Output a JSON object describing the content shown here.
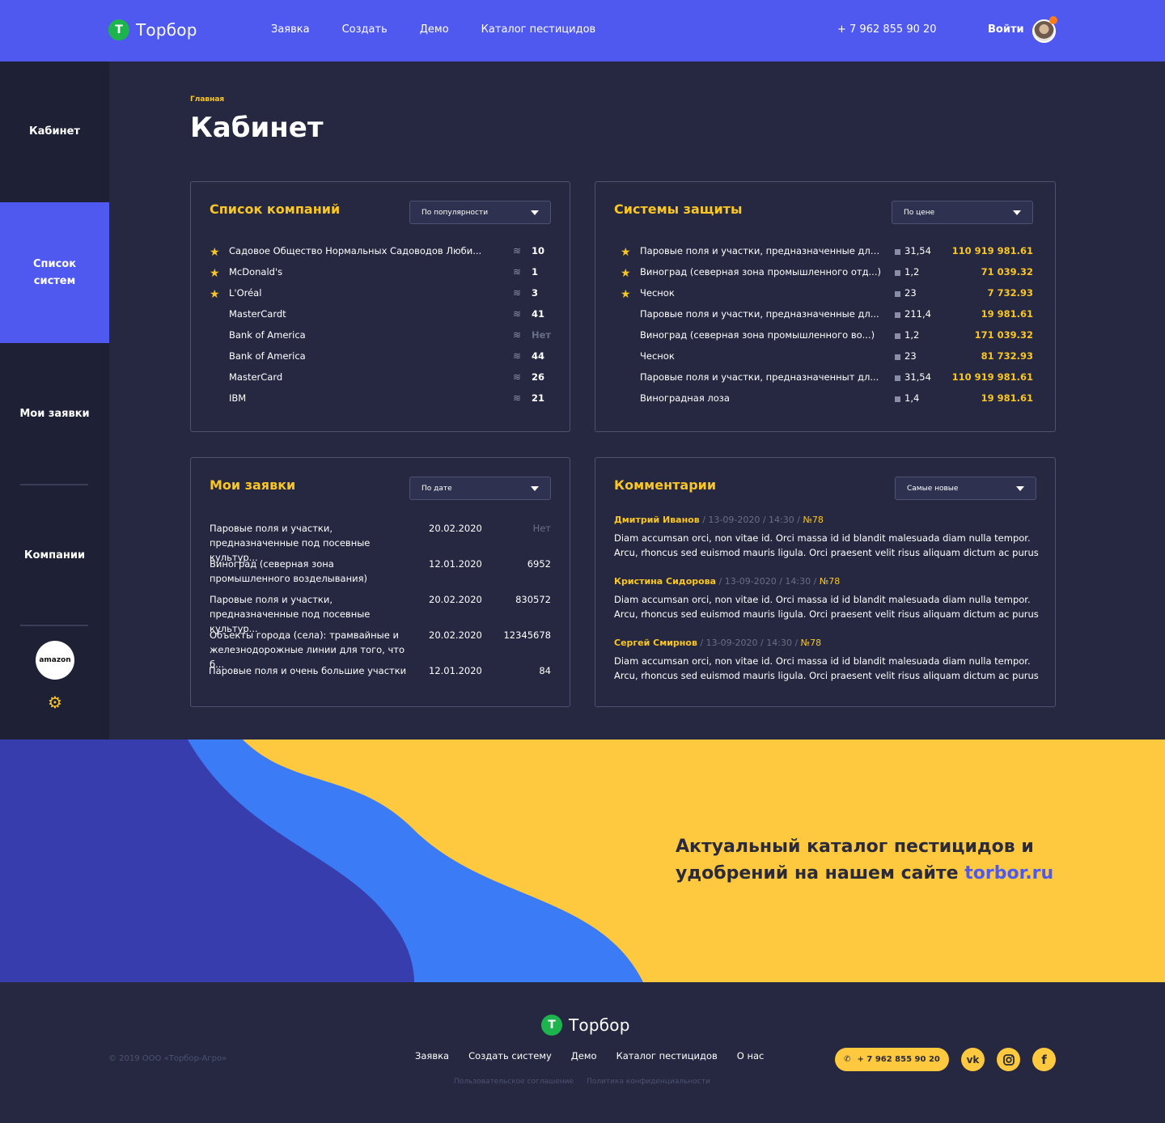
{
  "header": {
    "logo_mark": "Т",
    "logo_text": "Торбор",
    "nav": [
      "Заявка",
      "Создать",
      "Демо",
      "Каталог пестицидов"
    ],
    "phone": "+ 7 962 855 90 20",
    "login": "Войти"
  },
  "sidebar": {
    "items": [
      {
        "label": "Кабинет"
      },
      {
        "label": "Список систем"
      },
      {
        "label": "Мои заявки"
      },
      {
        "label": "Компании"
      }
    ],
    "company_logo": "amazon",
    "gear_icon": "⚙"
  },
  "page": {
    "breadcrumb": "Главная",
    "title": "Кабинет"
  },
  "companies": {
    "title": "Список компаний",
    "sort": "По популярности",
    "rows": [
      {
        "name": "Садовое Общество Нормальных Садоводов Люби...",
        "starred": true,
        "count": "10"
      },
      {
        "name": "McDonald's",
        "starred": true,
        "count": "1"
      },
      {
        "name": "L'Oréal",
        "starred": true,
        "count": "3"
      },
      {
        "name": "MasterCardt",
        "starred": false,
        "count": "41"
      },
      {
        "name": "Bank of America",
        "starred": false,
        "count": "Нет"
      },
      {
        "name": "Bank of America",
        "starred": false,
        "count": "44"
      },
      {
        "name": "MasterCard",
        "starred": false,
        "count": "26"
      },
      {
        "name": "IBM",
        "starred": false,
        "count": "21"
      }
    ]
  },
  "systems": {
    "title": "Системы защиты",
    "sort": "По цене",
    "rows": [
      {
        "name": "Паровые поля и участки, предназначенные для...",
        "starred": true,
        "area": "31,54",
        "price": "110 919 981.61"
      },
      {
        "name": "Виноград (северная зона промышленного отд...)",
        "starred": true,
        "area": "1,2",
        "price": "71 039.32"
      },
      {
        "name": "Чеснок",
        "starred": true,
        "area": "23",
        "price": "7 732.93"
      },
      {
        "name": "Паровые поля и участки, предназначенные дл...",
        "starred": false,
        "area": "211,4",
        "price": "19 981.61"
      },
      {
        "name": "Виноград (северная зона промышленного во...)",
        "starred": false,
        "area": "1,2",
        "price": "171 039.32"
      },
      {
        "name": "Чеснок",
        "starred": false,
        "area": "23",
        "price": "81 732.93"
      },
      {
        "name": "Паровые поля и участки, предназначенныт дл...",
        "starred": false,
        "area": "31,54",
        "price": "110 919 981.61"
      },
      {
        "name": "Виноградная лоза",
        "starred": false,
        "area": "1,4",
        "price": "19 981.61"
      }
    ]
  },
  "requests": {
    "title": "Мои заявки",
    "sort": "По дате",
    "rows": [
      {
        "name": "Паровые поля и участки, предназначенные под посевные культур...",
        "date": "20.02.2020",
        "value": "Нет"
      },
      {
        "name": "Виноград (северная зона промышленного возделывания)",
        "date": "12.01.2020",
        "value": "6952"
      },
      {
        "name": "Паровые поля и участки, предназначенные под посевные культур...",
        "date": "20.02.2020",
        "value": "830572"
      },
      {
        "name": "Объекты города (села): трамвайные и железнодорожные линии для того, что б...",
        "date": "20.02.2020",
        "value": "12345678"
      },
      {
        "name": "Паровые поля и очень большие участки",
        "date": "12.01.2020",
        "value": "84"
      }
    ]
  },
  "comments": {
    "title": "Комментарии",
    "sort": "Самые новые",
    "items": [
      {
        "author": "Дмитрий Иванов",
        "meta": " / 13-09-2020 / 14:30 / ",
        "num": "№78",
        "body": "Diam accumsan orci, non vitae id. Orci massa id id blandit malesuada diam nulla tempor. Arcu, rhoncus sed euismod mauris ligula. Orci praesent velit risus aliquam dictum ac purus mi eu i..."
      },
      {
        "author": "Кристина Сидорова",
        "meta": " / 13-09-2020 / 14:30 / ",
        "num": "№78",
        "body": "Diam accumsan orci, non vitae id. Orci massa id id blandit malesuada diam nulla tempor. Arcu, rhoncus sed euismod mauris ligula. Orci praesent velit risus aliquam dictum ac purus mi eu i..."
      },
      {
        "author": "Сергей Смирнов",
        "meta": " / 13-09-2020 / 14:30 / ",
        "num": "№78",
        "body": "Diam accumsan orci, non vitae id. Orci massa id id blandit malesuada diam nulla tempor. Arcu, rhoncus sed euismod mauris ligula. Orci praesent velit risus aliquam dictum ac purus mi eu i..."
      }
    ]
  },
  "banner": {
    "line1": "Актуальный каталог пестицидов и",
    "line2": "удобрений на нашем сайте ",
    "link": "torbor.ru"
  },
  "footer": {
    "logo_mark": "Т",
    "logo_text": "Торбор",
    "copyright": "© 2019 ООО «Торбор-Агро»",
    "nav": [
      "Заявка",
      "Создать систему",
      "Демо",
      "Каталог пестицидов",
      "О нас"
    ],
    "legal": [
      "Пользовательское соглашение",
      "Политика конфиденциальности"
    ],
    "phone": "+ 7 962 855 90 20",
    "social": [
      "vk-icon",
      "instagram-icon",
      "facebook-icon"
    ]
  },
  "colors": {
    "accent": "#5059EF",
    "yellow": "#F9C623",
    "bg": "#252840",
    "sidebar": "#1E2035",
    "green": "#1DB34D"
  }
}
